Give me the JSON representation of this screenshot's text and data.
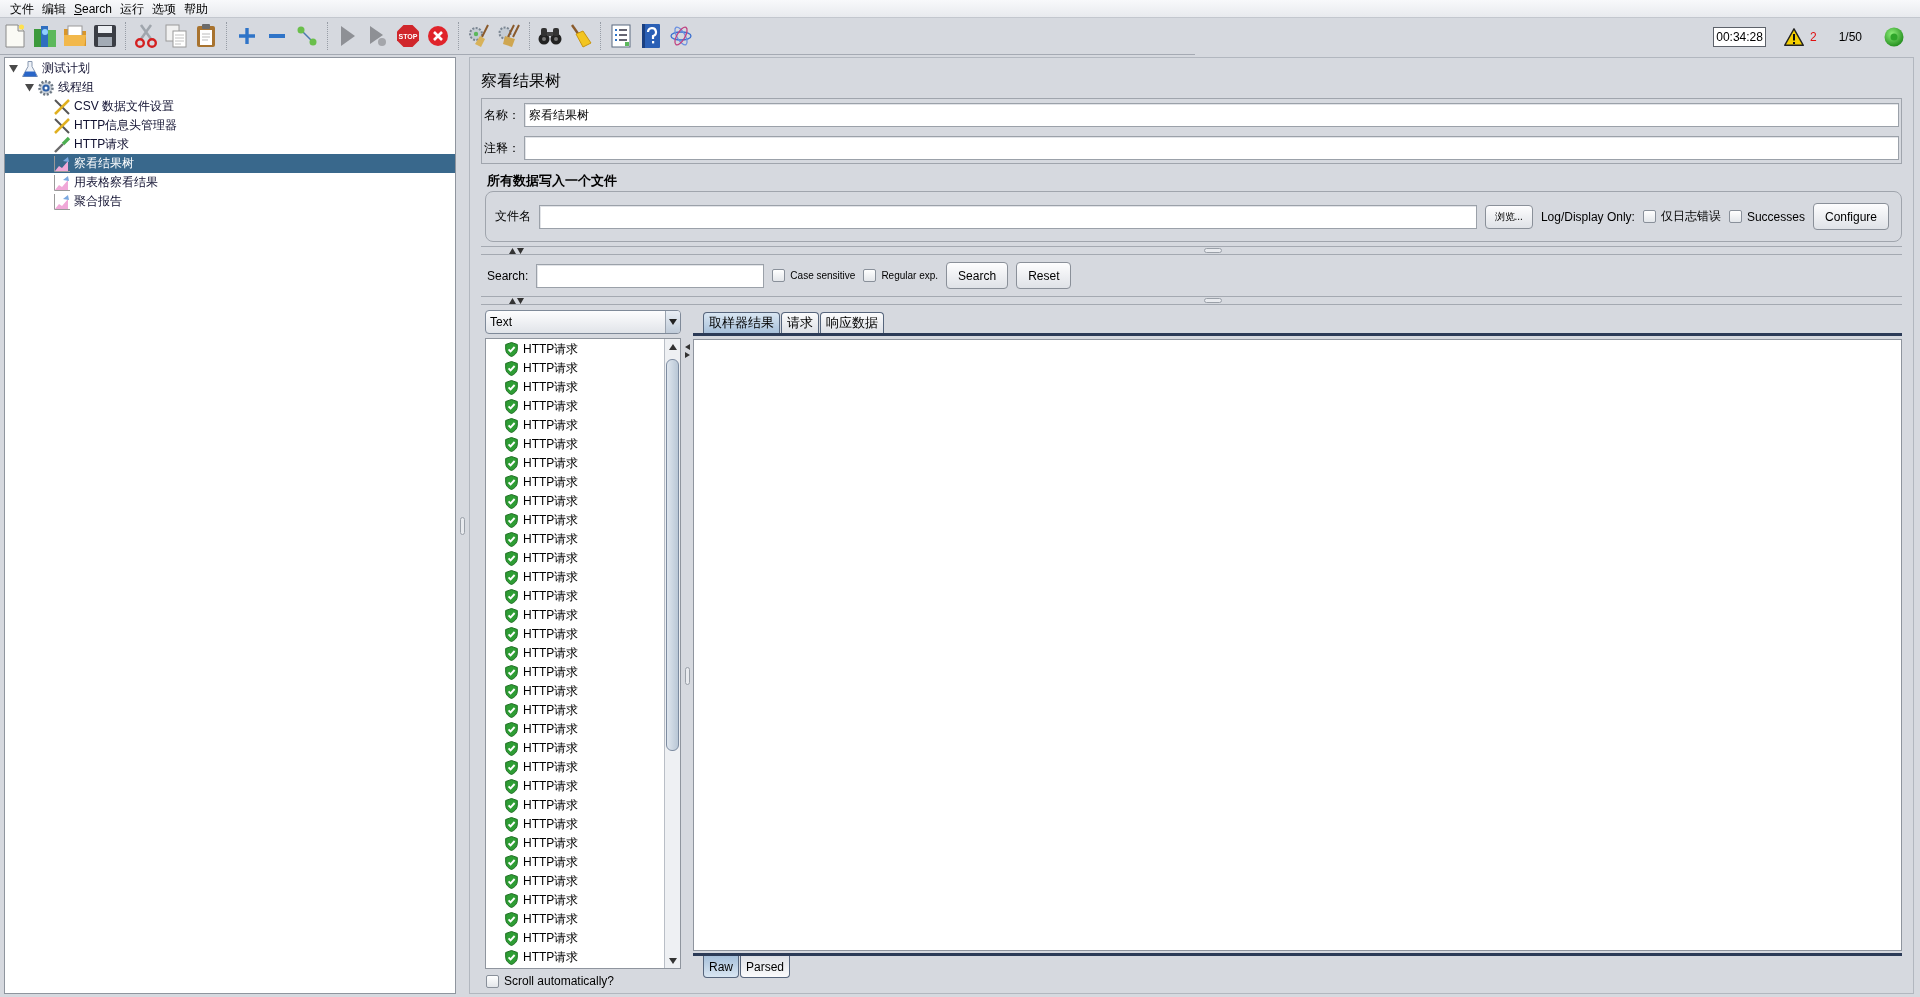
{
  "menu": [
    {
      "label": "文件",
      "underline_first": false
    },
    {
      "label": "编辑",
      "underline_first": false
    },
    {
      "label": "Search",
      "underline_first": true
    },
    {
      "label": "运行",
      "underline_first": false
    },
    {
      "label": "选项",
      "underline_first": false
    },
    {
      "label": "帮助",
      "underline_first": false
    }
  ],
  "toolbar": {
    "run_controls": [
      {
        "kind": "start",
        "disabled": true
      },
      {
        "kind": "start_no_pauses",
        "disabled": true
      },
      {
        "kind": "stop",
        "label": "STOP",
        "disabled": false
      },
      {
        "kind": "shutdown",
        "disabled": false
      }
    ]
  },
  "status": {
    "elapsed": "00:34:28",
    "warnings": "2",
    "threads": "1/50",
    "running": true
  },
  "tree": [
    {
      "kind": "plan",
      "label": "测试计划",
      "expanded": true,
      "selected": false,
      "children": [
        {
          "kind": "threads",
          "label": "线程组",
          "expanded": true,
          "selected": false,
          "children": [
            {
              "kind": "config",
              "label": "CSV 数据文件设置",
              "selected": false
            },
            {
              "kind": "config",
              "label": "HTTP信息头管理器",
              "selected": false
            },
            {
              "kind": "sampler",
              "label": "HTTP请求",
              "selected": false
            },
            {
              "kind": "listener",
              "label": "察看结果树",
              "selected": true
            },
            {
              "kind": "listener",
              "label": "用表格察看结果",
              "selected": false
            },
            {
              "kind": "listener",
              "label": "聚合报告",
              "selected": false
            }
          ]
        }
      ]
    }
  ],
  "editor": {
    "title": "察看结果树",
    "name_field": {
      "label": "名称：",
      "value": "察看结果树"
    },
    "comment_field": {
      "label": "注释："
    }
  },
  "file_section": {
    "heading": "所有数据写入一个文件",
    "label": "文件名",
    "browse_button": "浏览...",
    "log_display_label": "Log/Display Only:",
    "checkboxes": [
      {
        "label": "仅日志错误",
        "checked": false
      },
      {
        "label": "Successes",
        "checked": false
      }
    ],
    "configure_button": "Configure"
  },
  "search_bar": {
    "label": "Search:",
    "options": [
      {
        "label": "Case sensitive",
        "checked": false
      },
      {
        "label": "Regular exp.",
        "checked": false
      }
    ],
    "buttons": [
      "Search",
      "Reset"
    ]
  },
  "results": {
    "renderer": "Text",
    "items": [
      {
        "label": "HTTP请求",
        "success": true
      },
      {
        "label": "HTTP请求",
        "success": true
      },
      {
        "label": "HTTP请求",
        "success": true
      },
      {
        "label": "HTTP请求",
        "success": true
      },
      {
        "label": "HTTP请求",
        "success": true
      },
      {
        "label": "HTTP请求",
        "success": true
      },
      {
        "label": "HTTP请求",
        "success": true
      },
      {
        "label": "HTTP请求",
        "success": true
      },
      {
        "label": "HTTP请求",
        "success": true
      },
      {
        "label": "HTTP请求",
        "success": true
      },
      {
        "label": "HTTP请求",
        "success": true
      },
      {
        "label": "HTTP请求",
        "success": true
      },
      {
        "label": "HTTP请求",
        "success": true
      },
      {
        "label": "HTTP请求",
        "success": true
      },
      {
        "label": "HTTP请求",
        "success": true
      },
      {
        "label": "HTTP请求",
        "success": true
      },
      {
        "label": "HTTP请求",
        "success": true
      },
      {
        "label": "HTTP请求",
        "success": true
      },
      {
        "label": "HTTP请求",
        "success": true
      },
      {
        "label": "HTTP请求",
        "success": true
      },
      {
        "label": "HTTP请求",
        "success": true
      },
      {
        "label": "HTTP请求",
        "success": true
      },
      {
        "label": "HTTP请求",
        "success": true
      },
      {
        "label": "HTTP请求",
        "success": true
      },
      {
        "label": "HTTP请求",
        "success": true
      },
      {
        "label": "HTTP请求",
        "success": true
      },
      {
        "label": "HTTP请求",
        "success": true
      },
      {
        "label": "HTTP请求",
        "success": true
      },
      {
        "label": "HTTP请求",
        "success": true
      },
      {
        "label": "HTTP请求",
        "success": true
      },
      {
        "label": "HTTP请求",
        "success": true
      },
      {
        "label": "HTTP请求",
        "success": true
      },
      {
        "label": "HTTP请求",
        "success": true
      }
    ],
    "scroll_automatically": {
      "label": "Scroll automatically?",
      "checked": false
    }
  },
  "detail_tabs": [
    {
      "label": "取样器结果",
      "selected": true
    },
    {
      "label": "请求",
      "selected": false
    },
    {
      "label": "响应数据",
      "selected": false
    }
  ],
  "view_tabs": [
    {
      "label": "Raw",
      "selected": true
    },
    {
      "label": "Parsed",
      "selected": false
    }
  ]
}
